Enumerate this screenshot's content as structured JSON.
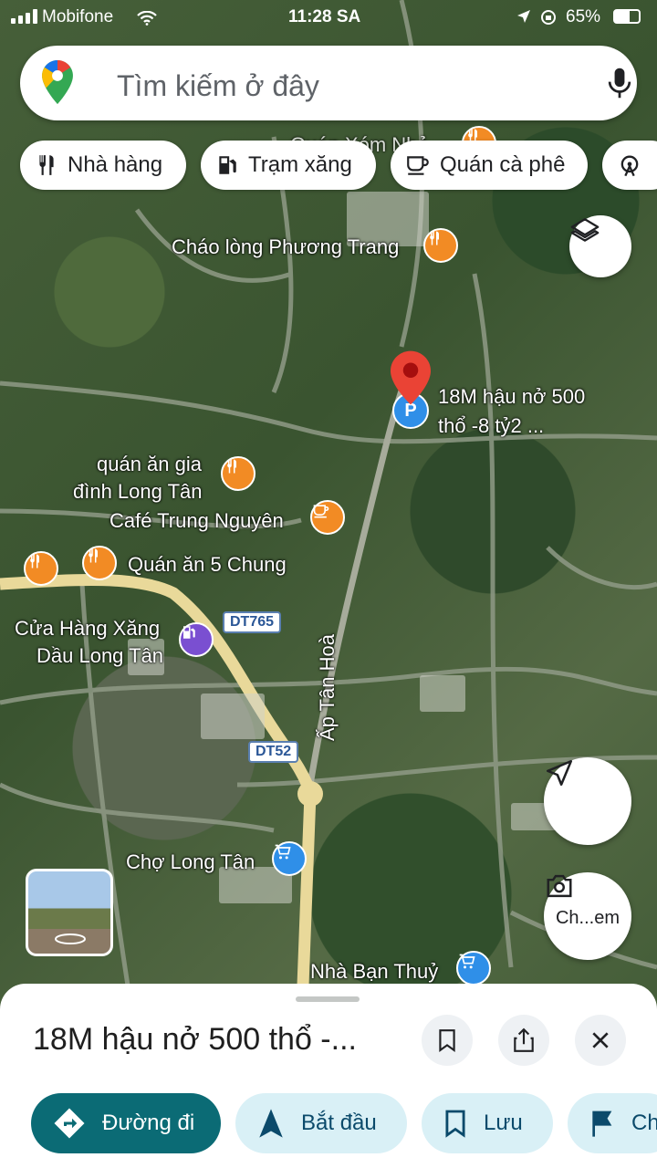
{
  "status_bar": {
    "carrier": "Mobifone",
    "time": "11:28 SA",
    "battery": "65%"
  },
  "search": {
    "placeholder": "Tìm kiếm ở đây"
  },
  "chips": [
    {
      "label": "Nhà hàng",
      "icon": "restaurant-icon"
    },
    {
      "label": "Trạm xăng",
      "icon": "gas-station-icon"
    },
    {
      "label": "Quán cà phê",
      "icon": "coffee-icon"
    },
    {
      "label": "",
      "icon": "attraction-icon"
    }
  ],
  "map": {
    "labels": {
      "partial_top": "Quán Xóm Nhỏ",
      "chao_long": "Cháo lòng Phương Trang",
      "selected_pin_line1": "18M hậu nở 500",
      "selected_pin_line2": "thổ -8 tỷ2 ...",
      "quan_an_line1": "quán ăn gia",
      "quan_an_line2": "đình Long Tân",
      "cafe": "Café Trung Nguyên",
      "quan_an_5": "Quán ăn 5 Chung",
      "xang_line1": "Cửa Hàng Xăng",
      "xang_line2": "Dầu Long Tân",
      "road": "Ấp Tân Hoà",
      "cho": "Chợ Long Tân",
      "nha_ban": "Nhà Bạn Thuỷ"
    },
    "shields": {
      "dt765": "DT765",
      "dt52": "DT52"
    },
    "camera_label": "Ch...em",
    "accent_color": "#ea4335"
  },
  "sheet": {
    "title": "18M hậu nở 500 thổ -...",
    "actions": [
      {
        "label": "Đường đi",
        "icon": "directions-icon"
      },
      {
        "label": "Bắt đầu",
        "icon": "navigation-arrow-icon"
      },
      {
        "label": "Lưu",
        "icon": "bookmark-icon"
      },
      {
        "label": "Ch",
        "icon": "flag-icon"
      }
    ]
  }
}
